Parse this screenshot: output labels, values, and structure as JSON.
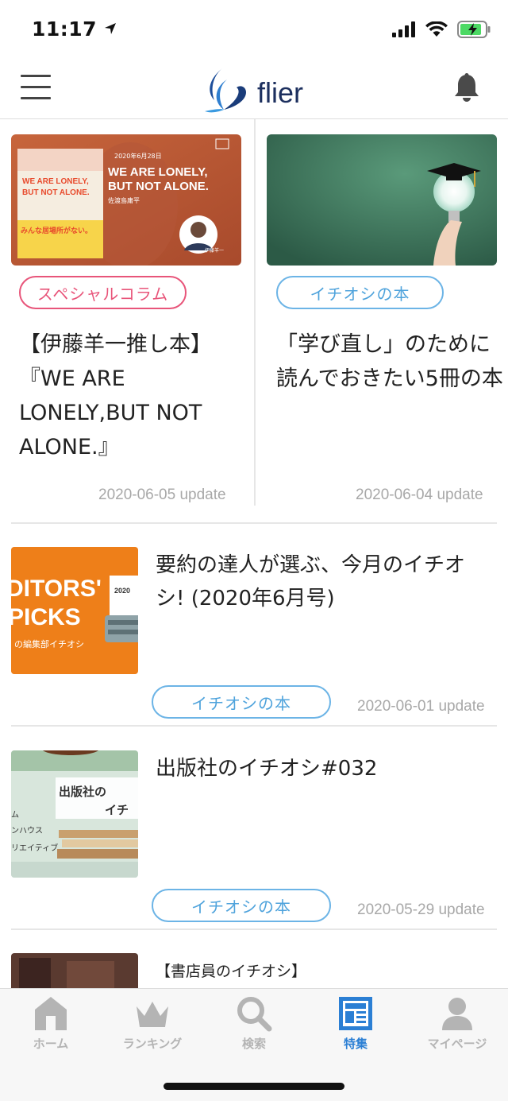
{
  "status": {
    "time": "11:17"
  },
  "header": {
    "logo_text": "flier",
    "menu_icon": "hamburger-icon",
    "bell_icon": "bell-icon"
  },
  "featured": [
    {
      "tag": "スペシャルコラム",
      "tag_color": "#e8557a",
      "title": "【伊藤羊一推し本】『WE ARE LONELY,BUT NOT ALONE.』",
      "update": "2020-06-05 update",
      "image": {
        "banner_date": "2020年6月28日",
        "banner_title_1": "WE ARE LONELY,",
        "banner_title_2": "BUT NOT ALONE.",
        "banner_author": "佐渡島庸平",
        "book_title_1": "WE ARE LONELY,",
        "book_title_2": "BUT NOT ALONE.",
        "book_band": "みんな居場所がない。",
        "person_name": "伊藤羊一"
      }
    },
    {
      "tag": "イチオシの本",
      "tag_color": "#4fa3dc",
      "title": "「学び直し」のために読んでおきたい5冊の本",
      "update": "2020-06-04 update"
    }
  ],
  "list": [
    {
      "title": "要約の達人が選ぶ、今月のイチオシ! (2020年6月号)",
      "tag": "イチオシの本",
      "update": "2020-06-01 update",
      "thumb_text_1": "DITORS'",
      "thumb_text_2": "PICKS",
      "thumb_text_3": "の編集部イチオシ",
      "thumb_text_4": "2020"
    },
    {
      "title": "出版社のイチオシ#032",
      "tag": "イチオシの本",
      "update": "2020-05-29 update",
      "thumb_text_1": "出版社の",
      "thumb_text_2": "イチ",
      "thumb_text_3": "ム",
      "thumb_text_4": "ンハウス",
      "thumb_text_5": "リエイティブ"
    },
    {
      "title": "【書店員のイチオシ】"
    }
  ],
  "tabs": [
    {
      "label": "ホーム",
      "icon": "home-icon",
      "active": false
    },
    {
      "label": "ランキング",
      "icon": "crown-icon",
      "active": false
    },
    {
      "label": "検索",
      "icon": "search-icon",
      "active": false
    },
    {
      "label": "特集",
      "icon": "feature-icon",
      "active": true
    },
    {
      "label": "マイページ",
      "icon": "person-icon",
      "active": false
    }
  ],
  "colors": {
    "accent_blue": "#2b7fd4",
    "tag_pink": "#e8557a",
    "tag_blue": "#4fa3dc",
    "logo_navy": "#1c2f5e"
  }
}
